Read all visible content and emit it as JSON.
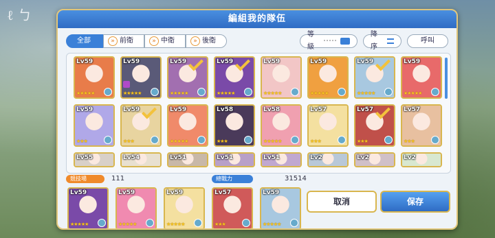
{
  "dialog": {
    "title": "編組我的隊伍"
  },
  "filters": {
    "all": "全部",
    "front": "前衛",
    "middle": "中衛",
    "back": "後衛"
  },
  "sort": {
    "level": "等級",
    "order": "降序",
    "call": "呼叫"
  },
  "roster_row1": [
    {
      "lv": "Lv59",
      "stars": "★★★★★",
      "checked": false,
      "bg": "#e87c4a"
    },
    {
      "lv": "Lv59",
      "stars": "★★★★★",
      "checked": false,
      "bg": "#5a5a78",
      "arena": true
    },
    {
      "lv": "Lv59",
      "stars": "★★★★★",
      "checked": true,
      "bg": "#a26fb0"
    },
    {
      "lv": "Lv59",
      "stars": "★★★★★",
      "checked": true,
      "bg": "#7a4aa8"
    },
    {
      "lv": "Lv59",
      "stars": "★★★★★",
      "checked": false,
      "bg": "#f2c6c6"
    },
    {
      "lv": "Lv59",
      "stars": "★★★★★",
      "checked": false,
      "bg": "#f0a040"
    },
    {
      "lv": "Lv59",
      "stars": "★★★★★",
      "checked": true,
      "bg": "#a8c8e0"
    },
    {
      "lv": "Lv59",
      "stars": "★★★★★",
      "checked": false,
      "bg": "#e86a6a"
    }
  ],
  "roster_row2": [
    {
      "lv": "Lv59",
      "stars": "★★★",
      "checked": false,
      "bg": "#b0a8e8"
    },
    {
      "lv": "Lv59",
      "stars": "★★★",
      "checked": true,
      "bg": "#e8d4a0"
    },
    {
      "lv": "Lv59",
      "stars": "★★★★★",
      "checked": false,
      "bg": "#f08a6a"
    },
    {
      "lv": "Lv58",
      "stars": "★★★",
      "checked": false,
      "bg": "#4a3a5a"
    },
    {
      "lv": "Lv58",
      "stars": "★★★★★",
      "checked": false,
      "bg": "#f0a0b0"
    },
    {
      "lv": "Lv57",
      "stars": "★★★",
      "checked": false,
      "bg": "#f4e0a0"
    },
    {
      "lv": "Lv57",
      "stars": "★★★",
      "checked": true,
      "bg": "#c0504a"
    },
    {
      "lv": "Lv57",
      "stars": "★★★",
      "checked": false,
      "bg": "#e8c0a0"
    }
  ],
  "roster_row3": [
    {
      "lv": "Lv55",
      "bg": "#d8d0c8"
    },
    {
      "lv": "Lv54",
      "bg": "#e8e0d0"
    },
    {
      "lv": "Lv51",
      "bg": "#c8b8a8"
    },
    {
      "lv": "Lv51",
      "bg": "#b8a0c8"
    },
    {
      "lv": "Lv51",
      "bg": "#c0a8d0"
    },
    {
      "lv": "Lv2",
      "bg": "#b8c8d8"
    },
    {
      "lv": "Lv2",
      "bg": "#d0c0c8"
    },
    {
      "lv": "Lv2",
      "bg": "#d8e8d0"
    }
  ],
  "stats": {
    "arena_label": "競技場",
    "arena_value": "111",
    "power_label": "總戰力",
    "power_value": "31514"
  },
  "team": [
    {
      "lv": "Lv59",
      "stars": "★★★★★",
      "bg": "#7a4aa8"
    },
    {
      "lv": "Lv59",
      "stars": "★★★★★",
      "bg": "#f08ab0"
    },
    {
      "lv": "Lv59",
      "stars": "★★★★★",
      "bg": "#f4e0a0"
    },
    {
      "lv": "Lv57",
      "stars": "★★★",
      "bg": "#d05a5a"
    },
    {
      "lv": "Lv59",
      "stars": "★★★★★",
      "bg": "#a8c8e0"
    }
  ],
  "buttons": {
    "cancel": "取消",
    "save": "保存"
  }
}
